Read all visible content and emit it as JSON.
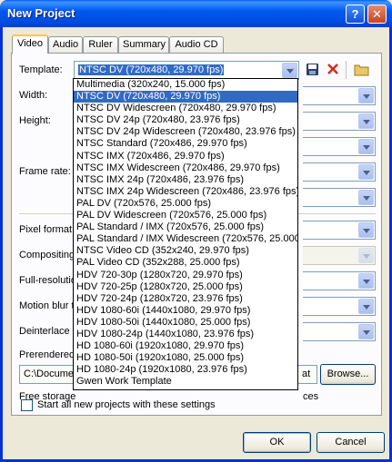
{
  "window": {
    "title": "New Project",
    "help": "?",
    "close": "✕"
  },
  "tabs": [
    "Video",
    "Audio",
    "Ruler",
    "Summary",
    "Audio CD"
  ],
  "fields": {
    "template_label": "Template:",
    "template_value": "NTSC DV (720x480, 29.970 fps)",
    "width_label": "Width:",
    "height_label": "Height:",
    "frame_rate_label": "Frame rate:",
    "pixel_format_label": "Pixel format:",
    "compositing_label": "Compositing",
    "full_resolution_label": "Full-resolutio",
    "motion_blur_label": "Motion blur t",
    "deinterlace_label": "Deinterlace n",
    "prerendered_label": "Prerendered",
    "folder_value": "C:\\Documen",
    "folder_value_tail": "at",
    "browse_button": "Browse...",
    "free_storage": "Free storage",
    "free_storage_tail": "ces"
  },
  "checkbox": {
    "label": "Start all new projects with these settings",
    "checked": false
  },
  "buttons": {
    "ok": "OK",
    "cancel": "Cancel"
  },
  "dropdown": {
    "items": [
      "Multimedia (320x240, 15.000 fps)",
      "NTSC DV (720x480, 29.970 fps)",
      "NTSC DV Widescreen (720x480, 29.970 fps)",
      "NTSC DV 24p (720x480, 23.976 fps)",
      "NTSC DV 24p Widescreen (720x480, 23.976 fps)",
      "NTSC Standard (720x486, 29.970 fps)",
      "NTSC IMX (720x486, 29.970 fps)",
      "NTSC IMX Widescreen (720x486, 29.970 fps)",
      "NTSC IMX 24p (720x486, 23.976 fps)",
      "NTSC IMX 24p Widescreen (720x486, 23.976 fps)",
      "PAL DV (720x576, 25.000 fps)",
      "PAL DV Widescreen (720x576, 25.000 fps)",
      "PAL Standard / IMX (720x576, 25.000 fps)",
      "PAL Standard / IMX Widescreen (720x576, 25.000",
      "NTSC Video CD (352x240, 29.970 fps)",
      "PAL Video CD (352x288, 25.000 fps)",
      "HDV 720-30p (1280x720, 29.970 fps)",
      "HDV 720-25p (1280x720, 25.000 fps)",
      "HDV 720-24p (1280x720, 23.976 fps)",
      "HDV 1080-60i (1440x1080, 29.970 fps)",
      "HDV 1080-50i (1440x1080, 25.000 fps)",
      "HDV 1080-24p (1440x1080, 23.976 fps)",
      "HD 1080-60i (1920x1080, 29.970 fps)",
      "HD 1080-50i (1920x1080, 25.000 fps)",
      "HD 1080-24p (1920x1080, 23.976 fps)",
      "Gwen Work Template"
    ],
    "selected_index": 1
  },
  "icons": [
    "save-icon",
    "delete-icon",
    "folder-icon"
  ],
  "colors": {
    "selection": "#316ac5",
    "delete": "#d9281c",
    "titlebar": "#0054e3"
  }
}
